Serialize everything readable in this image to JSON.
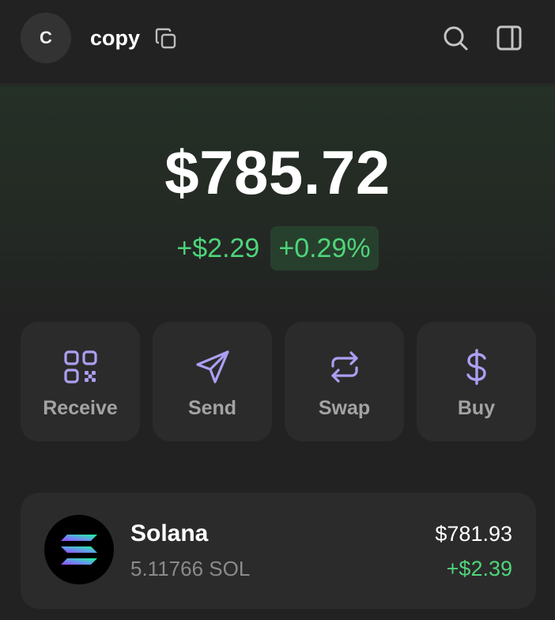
{
  "header": {
    "avatar_initial": "C",
    "account_name": "copy",
    "icons": [
      "copy-icon",
      "search-icon",
      "side-panel-icon"
    ]
  },
  "balance": {
    "total": "$785.72",
    "change_value": "+$2.29",
    "change_percent": "+0.29%"
  },
  "actions": [
    {
      "label": "Receive",
      "icon": "qr-code-icon"
    },
    {
      "label": "Send",
      "icon": "send-icon"
    },
    {
      "label": "Swap",
      "icon": "swap-icon"
    },
    {
      "label": "Buy",
      "icon": "dollar-icon"
    }
  ],
  "tokens": [
    {
      "name": "Solana",
      "amount": "5.11766 SOL",
      "value": "$781.93",
      "change": "+$2.39",
      "icon": "solana-logo-icon"
    }
  ],
  "colors": {
    "background": "#222222",
    "card": "#2b2b2b",
    "accent_purple": "#ab9ff2",
    "positive_green": "#4fd47a",
    "muted_text": "#a3a3a3"
  }
}
